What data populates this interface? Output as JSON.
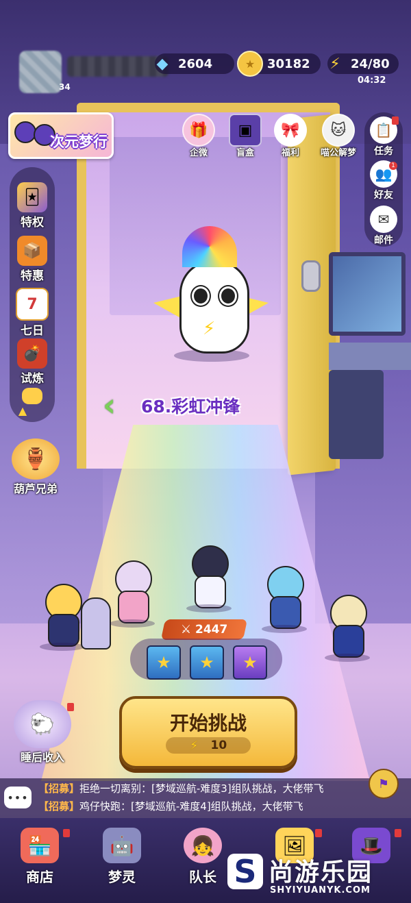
{
  "player": {
    "level": "34"
  },
  "resources": {
    "diamonds": "2604",
    "coins": "30182",
    "energy": "24/80",
    "energy_timer": "04:32"
  },
  "event_banner": {
    "label": "次元梦行"
  },
  "top_icons": [
    {
      "label": "企微",
      "icon": "gift-icon"
    },
    {
      "label": "盲盒",
      "icon": "blind-box-icon"
    },
    {
      "label": "福利",
      "icon": "welfare-gift-icon"
    },
    {
      "label": "喵公解梦",
      "icon": "cat-dream-icon"
    }
  ],
  "right_menu": [
    {
      "label": "任务",
      "icon": "task-list-icon"
    },
    {
      "label": "好友",
      "icon": "friends-icon",
      "badge": "1"
    },
    {
      "label": "邮件",
      "icon": "mail-icon"
    }
  ],
  "left_menu": [
    {
      "label": "特权",
      "icon": "privilege-card-icon"
    },
    {
      "label": "特惠",
      "icon": "discount-box-icon"
    },
    {
      "label": "七日",
      "icon": "calendar-icon",
      "day": "7"
    },
    {
      "label": "试炼",
      "icon": "trial-cannon-icon"
    }
  ],
  "gourd": {
    "label": "葫芦兄弟"
  },
  "stage": {
    "title": "68.彩虹冲锋"
  },
  "team": {
    "power": "2447"
  },
  "start": {
    "label": "开始挑战",
    "cost": "10"
  },
  "sleep_income": {
    "label": "睡后收入"
  },
  "chat": {
    "bubble": "•••",
    "messages": [
      {
        "tag": "【招募】",
        "text": "拒绝一切离别：[梦域巡航-难度3]组队挑战，大佬带飞"
      },
      {
        "tag": "【招募】",
        "text": "鸡仔快跑：[梦域巡航-难度4]组队挑战，大佬带飞"
      }
    ]
  },
  "nav": [
    {
      "label": "商店",
      "icon": "shop-icon"
    },
    {
      "label": "梦灵",
      "icon": "dream-spirit-icon"
    },
    {
      "label": "队长",
      "icon": "captain-icon"
    },
    {
      "label": "",
      "icon": "album-icon"
    },
    {
      "label": "",
      "icon": "magic-hat-icon"
    }
  ],
  "watermark": {
    "title": "尚游乐园",
    "url": "SHYIYUANYK.COM",
    "logo": "S"
  },
  "colors": {
    "stage_title": "#6a2fc0",
    "start_button": "#f4b83a",
    "chat_tag": "#ffb84a",
    "power_bar": "#e0602a"
  }
}
